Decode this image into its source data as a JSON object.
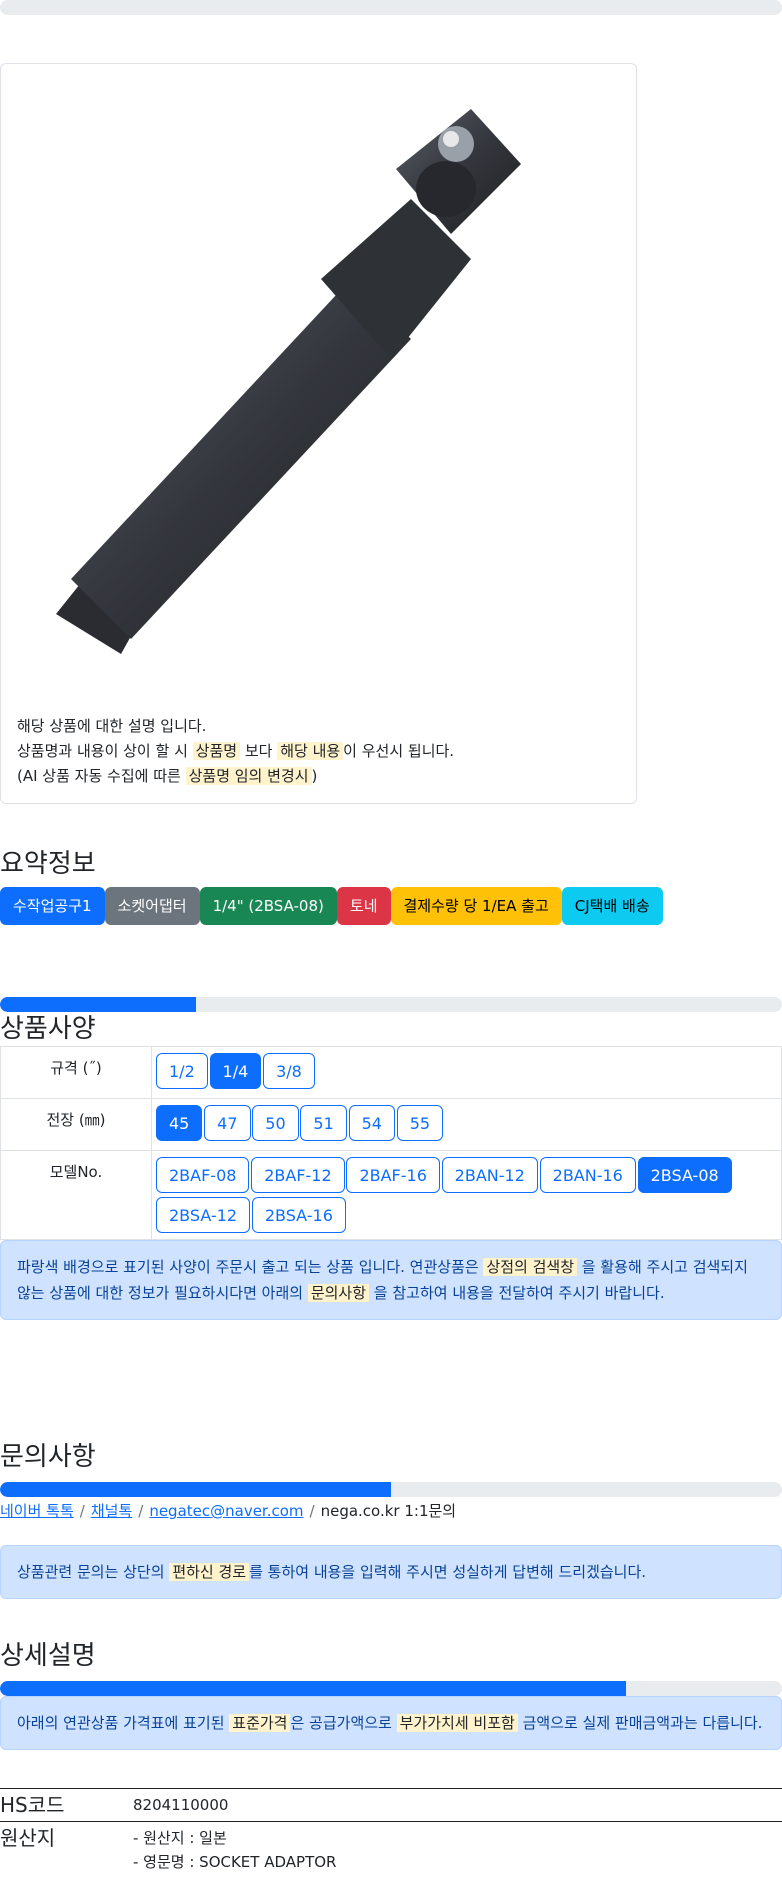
{
  "description": {
    "line1": "해당 상품에 대한 설명 입니다.",
    "line2_a": "상품명과 내용이 상이 할 시 ",
    "line2_mark1": "상품명",
    "line2_b": " 보다 ",
    "line2_mark2": "해당 내용",
    "line2_c": "이 우선시 됩니다.",
    "line3_a": "(AI 상품 자동 수집에 따른 ",
    "line3_mark": "상품명 임의 변경시",
    "line3_b": ")"
  },
  "summary": {
    "title": "요약정보",
    "badges": [
      "수작업공구1",
      "소켓어댑터",
      "1/4\" (2BSA-08)",
      "토네",
      "결제수량 당 1/EA 출고",
      "CJ택배 배송"
    ],
    "progress_fraction": 0.25
  },
  "spec": {
    "title": "상품사양",
    "rows": [
      {
        "label": "규격 (˝)",
        "options": [
          "1/2",
          "1/4",
          "3/8"
        ],
        "active": 1
      },
      {
        "label": "전장 (㎜)",
        "options": [
          "45",
          "47",
          "50",
          "51",
          "54",
          "55"
        ],
        "active": 0
      },
      {
        "label": "모델No.",
        "options": [
          "2BAF-08",
          "2BAF-12",
          "2BAF-16",
          "2BAN-12",
          "2BAN-16",
          "2BSA-08",
          "2BSA-12",
          "2BSA-16"
        ],
        "active": 5
      }
    ],
    "notice_a": "파랑색 배경으로 표기된 사양이 주문시 출고 되는 상품 입니다. 연관상품은 ",
    "notice_mark1": "상점의 검색창",
    "notice_b": " 을 활용해 주시고 검색되지 않는 상품에 대한 정보가 필요하시다면 아래의 ",
    "notice_mark2": "문의사항",
    "notice_c": " 을 참고하여 내용을 전달하여 주시기 바랍니다."
  },
  "inquiry": {
    "title": "문의사항",
    "progress_fraction": 0.5,
    "links": [
      "네이버 톡톡",
      "채널톡",
      "negatec@naver.com"
    ],
    "plain": "nega.co.kr 1:1문의",
    "notice_a": "상품관련 문의는 상단의 ",
    "notice_mark": "편하신 경로",
    "notice_b": "를 통하여 내용을 입력해 주시면 성실하게 답변해 드리겠습니다."
  },
  "detail": {
    "title": "상세설명",
    "progress_fraction": 0.8,
    "notice_a": "아래의 연관상품 가격표에 표기된 ",
    "notice_mark1": "표준가격",
    "notice_b": "은 공급가액으로 ",
    "notice_mark2": "부가가치세 비포함",
    "notice_c": " 금액으로 실제 판매금액과는 다릅니다.",
    "hs_label": "HS코드",
    "hs_value": "8204110000",
    "origin_label": "원산지",
    "origin_lines": [
      "- 원산지 : 일본",
      "- 영문명 : SOCKET ADAPTOR"
    ]
  },
  "colors": {
    "primary": "#0d6efd",
    "mark": "#fff3cd",
    "alert_bg": "#cfe2ff"
  }
}
